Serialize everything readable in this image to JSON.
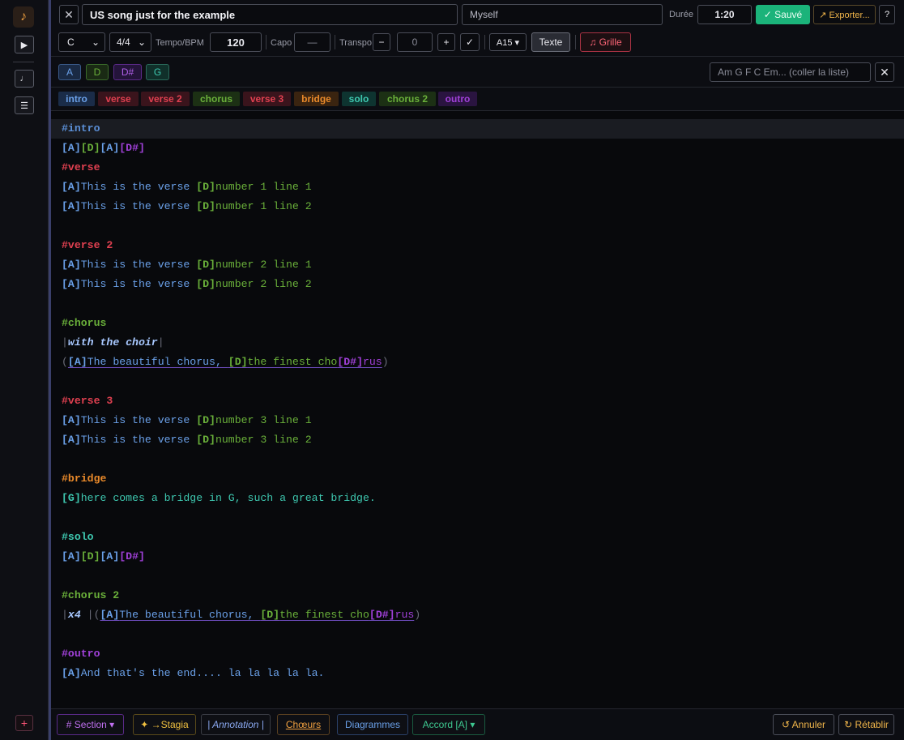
{
  "rail": {
    "logo_glyph": "♪",
    "play_glyph": "▶",
    "note_glyph": "♩",
    "list_glyph": "☰",
    "plus_glyph": "+"
  },
  "header": {
    "close_glyph": "✕",
    "title": "US song just for the example",
    "artist": "Myself",
    "duree_label": "Durée",
    "duree_value": "1:20",
    "saved_label": "✓ Sauvé",
    "export_label": "↗ Exporter...",
    "help_label": "?"
  },
  "settings": {
    "key": "C",
    "time_signature": "4/4",
    "dropdown_glyph": "⌄",
    "tempo_label": "Tempo/BPM",
    "tempo": "120",
    "capo_label": "Capo",
    "capo_value": "—",
    "transpo_label": "Transpo",
    "transpo_minus": "−",
    "transpo_value": "0",
    "transpo_plus": "+",
    "transpo_apply": "✓",
    "format": "A15 ▾",
    "texte_label": "Texte",
    "grille_label": "♫ Grille"
  },
  "chords": {
    "items": [
      "A",
      "D",
      "D#",
      "G"
    ],
    "input_placeholder": "Am G F C Em... (coller la liste)",
    "clear_glyph": "✕"
  },
  "sections": [
    "intro",
    "verse",
    "verse 2",
    "chorus",
    "verse 3",
    "bridge",
    "solo",
    "chorus 2",
    "outro"
  ],
  "lines": {
    "intro_tag": "#intro",
    "intro_chords": [
      "[A]",
      "[D]",
      "[A]",
      "[D#]"
    ],
    "verse_tag": "#verse",
    "v1l1_text_a": "This is the verse ",
    "v1l1_text_b": "number 1 line 1",
    "v1l2_text_b": "number 1 line 2",
    "verse2_tag": "#verse 2",
    "v2l1_text_b": "number 2 line 1",
    "v2l2_text_b": "number 2 line 2",
    "chorus_tag": "#chorus",
    "choir_note": "with the choir",
    "chorus_text_a": "The beautiful chorus, ",
    "chorus_text_b": "the finest cho",
    "chorus_text_c": "rus",
    "verse3_tag": "#verse 3",
    "v3l1_text_b": "number 3 line 1",
    "v3l2_text_b": "number 3 line 2",
    "bridge_tag": "#bridge",
    "bridge_text": "here comes a bridge in G, such a great bridge.",
    "solo_tag": "#solo",
    "chorus2_tag": "#chorus 2",
    "x4_note": "x4",
    "outro_tag": "#outro",
    "outro_text": "And that's the end.... la la la la la."
  },
  "bottom": {
    "section_btn": "# Section ▾",
    "stagia_btn": "✦ →Stagia",
    "annotation_btn": "| Annotation |",
    "choeurs_btn": "Chœurs",
    "diagrammes_btn": "Diagrammes",
    "accord_btn": "Accord [A] ▾",
    "undo_btn": "↺ Annuler",
    "redo_btn": "↻ Rétablir"
  },
  "colors": {
    "accent_green": "#1bb37a",
    "intro": "#5b8fd6",
    "verse": "#e04050",
    "chorus": "#6ab03a",
    "bridge": "#e8892a",
    "solo": "#3ec8b0",
    "outro": "#a040d8"
  }
}
